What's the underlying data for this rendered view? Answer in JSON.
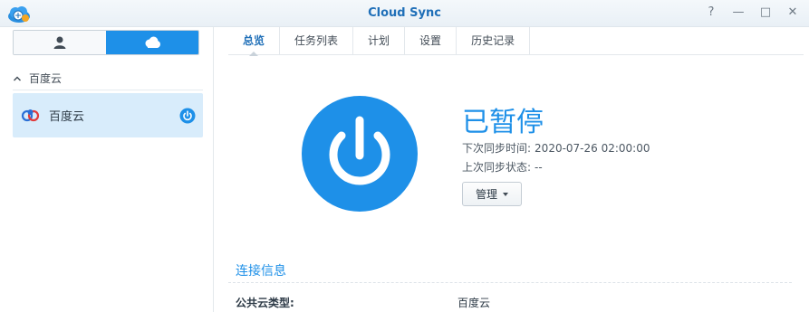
{
  "window": {
    "title": "Cloud Sync",
    "buttons": {
      "help": "?",
      "minimize": "—",
      "maximize": "□",
      "close": "✕"
    }
  },
  "sidebar": {
    "section_label": "百度云",
    "item_label": "百度云"
  },
  "tabs": [
    {
      "label": "总览",
      "active": true
    },
    {
      "label": "任务列表",
      "active": false
    },
    {
      "label": "计划",
      "active": false
    },
    {
      "label": "设置",
      "active": false
    },
    {
      "label": "历史记录",
      "active": false
    }
  ],
  "status": {
    "title": "已暂停",
    "next_sync_label": "下次同步时间:",
    "next_sync_value": "2020-07-26 02:00:00",
    "last_status_label": "上次同步状态:",
    "last_status_value": "--",
    "manage_label": "管理"
  },
  "connection": {
    "section_title": "连接信息",
    "cloud_type_label": "公共云类型:",
    "cloud_type_value": "百度云"
  },
  "colors": {
    "accent": "#1e90e8",
    "title_blue": "#1f6fb8",
    "selected_bg": "#d8ecfb"
  }
}
